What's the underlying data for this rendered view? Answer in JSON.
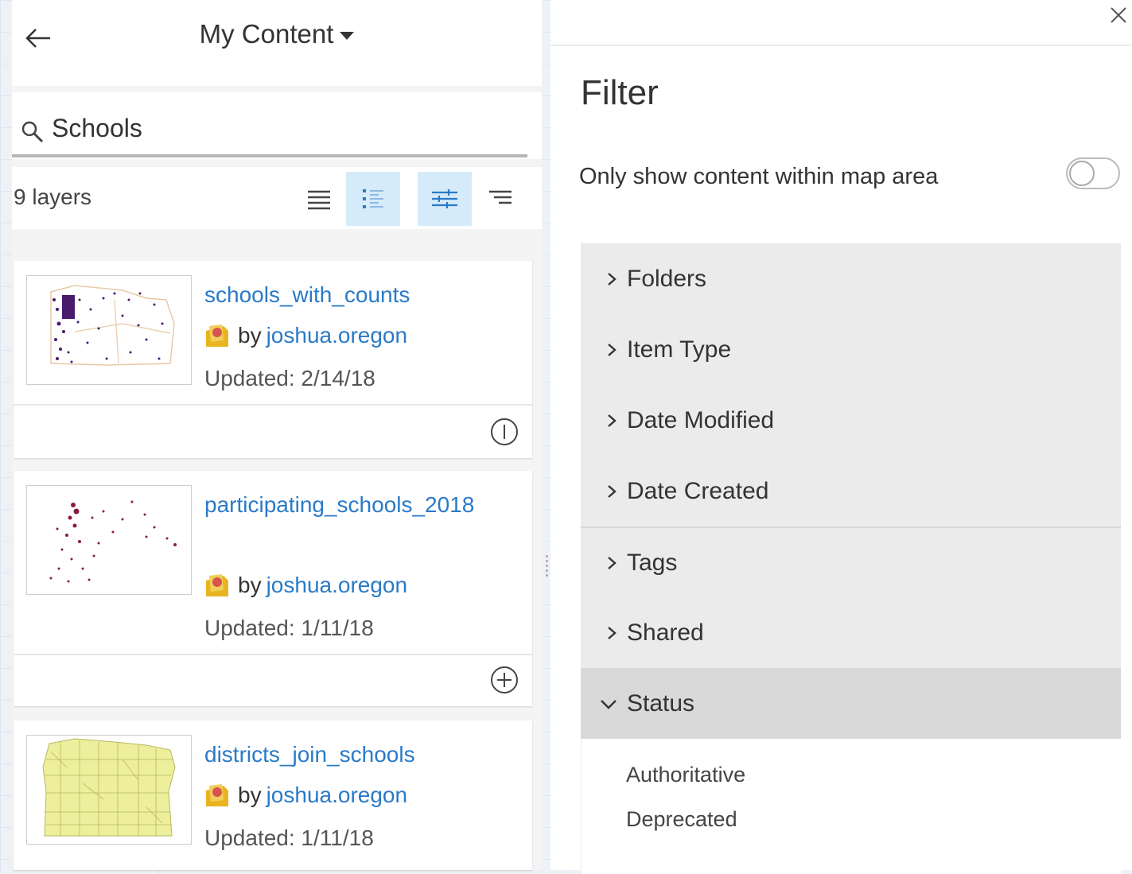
{
  "content_panel": {
    "title": "My Content",
    "search": {
      "value": "Schools"
    },
    "layer_count": "9 layers",
    "items": [
      {
        "title": "schools_with_counts",
        "owner_prefix": "by",
        "owner": "joshua.oregon",
        "updated": "Updated: 2/14/18",
        "action_icon": "info-icon"
      },
      {
        "title": "participating_schools_2018",
        "owner_prefix": "by",
        "owner": "joshua.oregon",
        "updated": "Updated: 1/11/18",
        "action_icon": "add-icon"
      },
      {
        "title": "districts_join_schools",
        "owner_prefix": "by",
        "owner": "joshua.oregon",
        "updated": "Updated: 1/11/18"
      }
    ]
  },
  "filter_panel": {
    "title": "Filter",
    "map_area_toggle": {
      "label": "Only show content within map area",
      "on": false
    },
    "sections": [
      {
        "label": "Folders",
        "expanded": false
      },
      {
        "label": "Item Type",
        "expanded": false
      },
      {
        "label": "Date Modified",
        "expanded": false
      },
      {
        "label": "Date Created",
        "expanded": false
      },
      {
        "label": "Tags",
        "expanded": false
      },
      {
        "label": "Shared",
        "expanded": false
      },
      {
        "label": "Status",
        "expanded": true
      }
    ],
    "status_options": [
      "Authoritative",
      "Deprecated"
    ]
  },
  "colors": {
    "link": "#2a7ac7",
    "active_button_bg": "#d6ebf9",
    "accordion_bg": "#ebebeb"
  }
}
